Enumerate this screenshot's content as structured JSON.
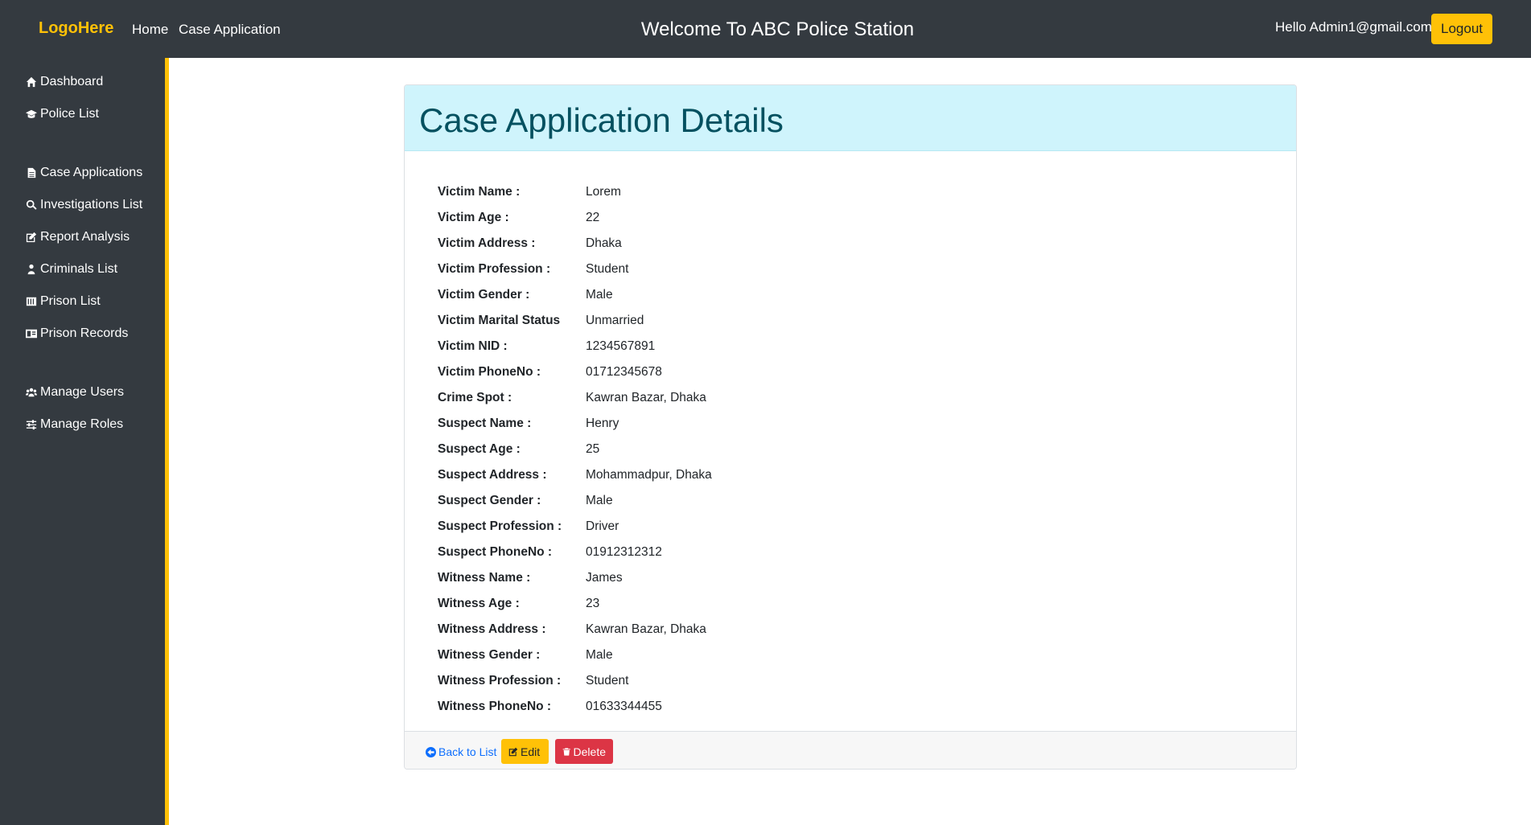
{
  "navbar": {
    "brand": "LogoHere",
    "links": [
      {
        "label": "Home"
      },
      {
        "label": "Case Application"
      }
    ],
    "title": "Welcome To ABC Police Station",
    "greeting": "Hello Admin1@gmail.com!",
    "logout_label": "Logout"
  },
  "sidebar": {
    "items": [
      {
        "label": "Dashboard",
        "icon": "home-icon"
      },
      {
        "label": "Police List",
        "icon": "graduation-cap-icon"
      },
      {
        "label": "Case Applications",
        "icon": "file-icon"
      },
      {
        "label": "Investigations List",
        "icon": "search-icon"
      },
      {
        "label": "Report Analysis",
        "icon": "edit-icon"
      },
      {
        "label": "Criminals List",
        "icon": "criminal-icon"
      },
      {
        "label": "Prison List",
        "icon": "prison-icon"
      },
      {
        "label": "Prison Records",
        "icon": "id-card-icon"
      },
      {
        "label": "Manage Users",
        "icon": "users-icon"
      },
      {
        "label": "Manage Roles",
        "icon": "sliders-icon"
      }
    ]
  },
  "card": {
    "title": "Case Application Details",
    "details": [
      {
        "label": "Victim Name :",
        "value": "Lorem"
      },
      {
        "label": "Victim Age :",
        "value": "22"
      },
      {
        "label": "Victim Address :",
        "value": "Dhaka"
      },
      {
        "label": "Victim Profession :",
        "value": "Student"
      },
      {
        "label": "Victim Gender :",
        "value": "Male"
      },
      {
        "label": "Victim Marital Status",
        "value": "Unmarried"
      },
      {
        "label": "Victim NID :",
        "value": "1234567891"
      },
      {
        "label": "Victim PhoneNo :",
        "value": "01712345678"
      },
      {
        "label": "Crime Spot :",
        "value": "Kawran Bazar, Dhaka"
      },
      {
        "label": "Suspect Name :",
        "value": "Henry"
      },
      {
        "label": "Suspect Age :",
        "value": "25"
      },
      {
        "label": "Suspect Address :",
        "value": "Mohammadpur, Dhaka"
      },
      {
        "label": "Suspect Gender :",
        "value": "Male"
      },
      {
        "label": "Suspect Profession :",
        "value": "Driver"
      },
      {
        "label": "Suspect PhoneNo :",
        "value": "01912312312"
      },
      {
        "label": "Witness Name :",
        "value": "James"
      },
      {
        "label": "Witness Age :",
        "value": "23"
      },
      {
        "label": "Witness Address :",
        "value": "Kawran Bazar, Dhaka"
      },
      {
        "label": "Witness Gender :",
        "value": "Male"
      },
      {
        "label": "Witness Profession :",
        "value": "Student"
      },
      {
        "label": "Witness PhoneNo :",
        "value": "01633344455"
      }
    ],
    "footer": {
      "back_label": "Back to List",
      "edit_label": "Edit",
      "delete_label": "Delete"
    }
  },
  "colors": {
    "navbar_bg": "#343a40",
    "accent": "#ffc107",
    "header_bg": "#cff4fc",
    "header_text": "#055160",
    "danger": "#dc3545",
    "link": "#0d6efd"
  }
}
